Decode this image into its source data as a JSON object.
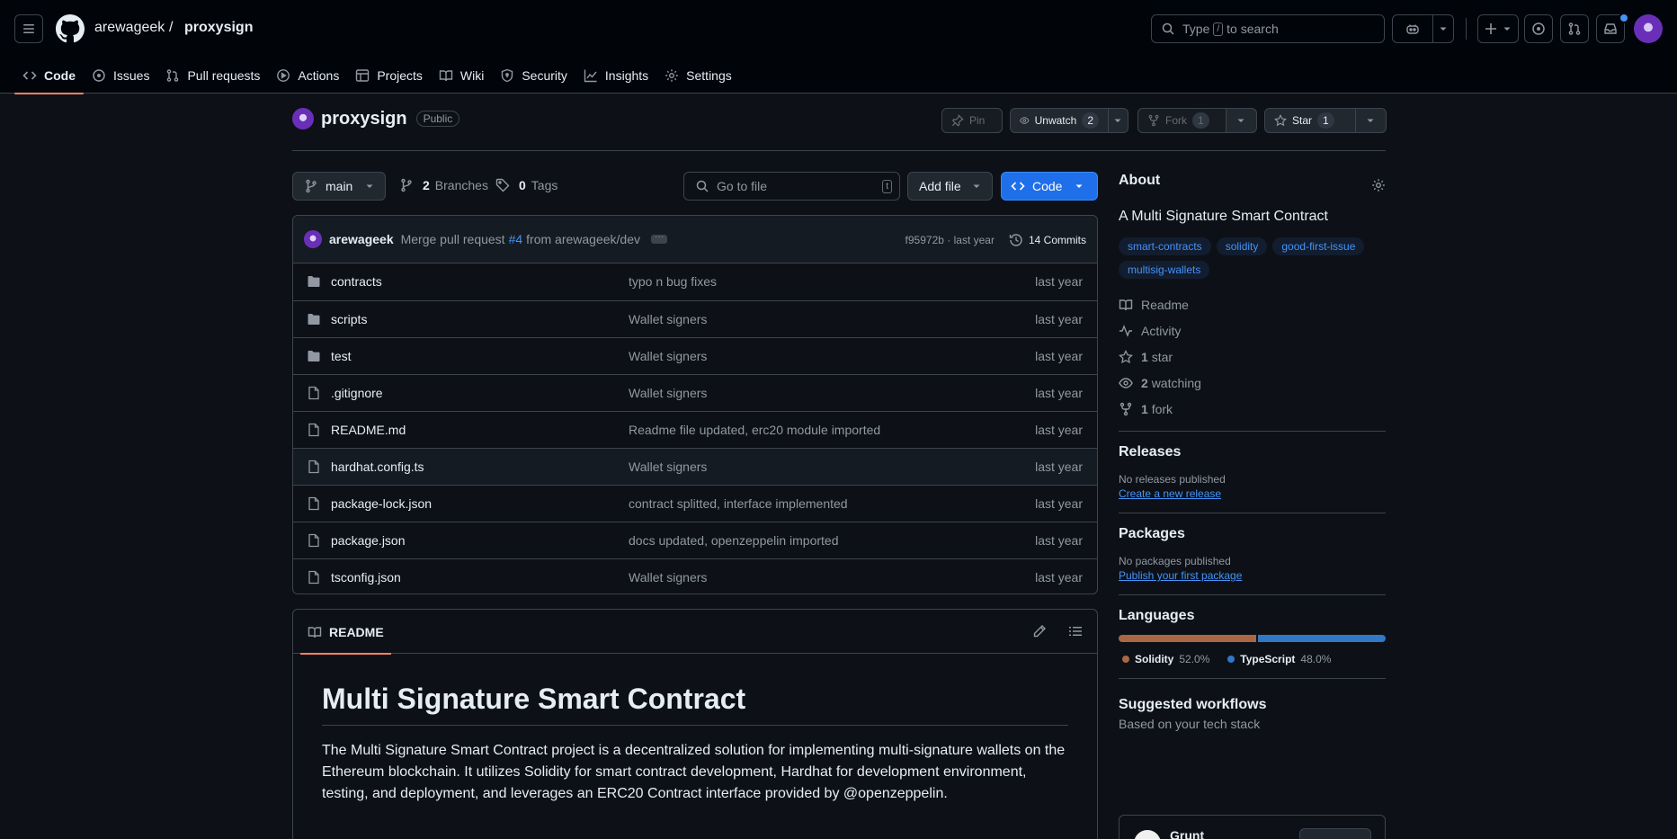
{
  "nav": {
    "owner": "arewageek",
    "separator": "/",
    "repo": "proxysign",
    "search": {
      "prefix": "Type",
      "key": "/",
      "suffix": "to search"
    },
    "tabs": [
      {
        "label": "Code",
        "icon": "code-icon",
        "active": true
      },
      {
        "label": "Issues",
        "icon": "issue-icon"
      },
      {
        "label": "Pull requests",
        "icon": "pull-request-icon"
      },
      {
        "label": "Actions",
        "icon": "play-icon"
      },
      {
        "label": "Projects",
        "icon": "table-icon"
      },
      {
        "label": "Wiki",
        "icon": "book-icon"
      },
      {
        "label": "Security",
        "icon": "shield-icon"
      },
      {
        "label": "Insights",
        "icon": "graph-icon"
      },
      {
        "label": "Settings",
        "icon": "gear-icon"
      }
    ]
  },
  "repo": {
    "name": "proxysign",
    "visibility": "Public",
    "pin": "Pin",
    "unwatch": "Unwatch",
    "watch_count": "2",
    "fork": "Fork",
    "fork_count": "1",
    "star": "Star",
    "star_count": "1"
  },
  "branch": {
    "name": "main",
    "branches_count": "2",
    "branches_label": "Branches",
    "tags_count": "0",
    "tags_label": "Tags",
    "goto_placeholder": "Go to file",
    "goto_key": "t",
    "add_file": "Add file",
    "code": "Code"
  },
  "commit": {
    "author": "arewageek",
    "message_prefix": "Merge pull request",
    "pr": "#4",
    "message_suffix": "from arewageek/dev",
    "hash": "f95972b",
    "dot": "·",
    "when": "last year",
    "commits": "14 Commits"
  },
  "files": [
    {
      "name": "contracts",
      "type": "dir",
      "message": "typo n bug fixes",
      "date": "last year"
    },
    {
      "name": "scripts",
      "type": "dir",
      "message": "Wallet signers",
      "date": "last year"
    },
    {
      "name": "test",
      "type": "dir",
      "message": "Wallet signers",
      "date": "last year"
    },
    {
      "name": ".gitignore",
      "type": "file",
      "message": "Wallet signers",
      "date": "last year"
    },
    {
      "name": "README.md",
      "type": "file",
      "message": "Readme file updated, erc20 module imported",
      "date": "last year"
    },
    {
      "name": "hardhat.config.ts",
      "type": "file",
      "message": "Wallet signers",
      "date": "last year"
    },
    {
      "name": "package-lock.json",
      "type": "file",
      "message": "contract splitted, interface implemented",
      "date": "last year"
    },
    {
      "name": "package.json",
      "type": "file",
      "message": "docs updated, openzeppelin imported",
      "date": "last year"
    },
    {
      "name": "tsconfig.json",
      "type": "file",
      "message": "Wallet signers",
      "date": "last year"
    }
  ],
  "readme": {
    "tab": "README",
    "heading": "Multi Signature Smart Contract",
    "paragraph": "The Multi Signature Smart Contract project is a decentralized solution for implementing multi-signature wallets on the Ethereum blockchain. It utilizes Solidity for smart contract development, Hardhat for development environment, testing, and deployment, and leverages an ERC20 Contract interface provided by @openzeppelin."
  },
  "about": {
    "title": "About",
    "description": "A Multi Signature Smart Contract",
    "topics": [
      "smart-contracts",
      "solidity",
      "good-first-issue",
      "multisig-wallets"
    ],
    "readme": "Readme",
    "activity": "Activity",
    "stars_count": "1",
    "stars_label": "star",
    "watching_count": "2",
    "watching_label": "watching",
    "forks_count": "1",
    "forks_label": "fork"
  },
  "releases": {
    "title": "Releases",
    "empty": "No releases published",
    "link": "Create a new release"
  },
  "packages": {
    "title": "Packages",
    "empty": "No packages published",
    "link": "Publish your first package"
  },
  "languages": {
    "title": "Languages",
    "items": [
      {
        "name": "Solidity",
        "percent": "52.0%",
        "value": 52.0,
        "color": "#aa6746"
      },
      {
        "name": "TypeScript",
        "percent": "48.0%",
        "value": 48.0,
        "color": "#3178c6"
      }
    ]
  },
  "workflows": {
    "title": "Suggested workflows",
    "subtitle": "Based on your tech stack",
    "first_name": "Grunt"
  },
  "colors": {
    "accent": "#f78166",
    "primary_button": "#1f6feb",
    "link": "#4493f8"
  }
}
